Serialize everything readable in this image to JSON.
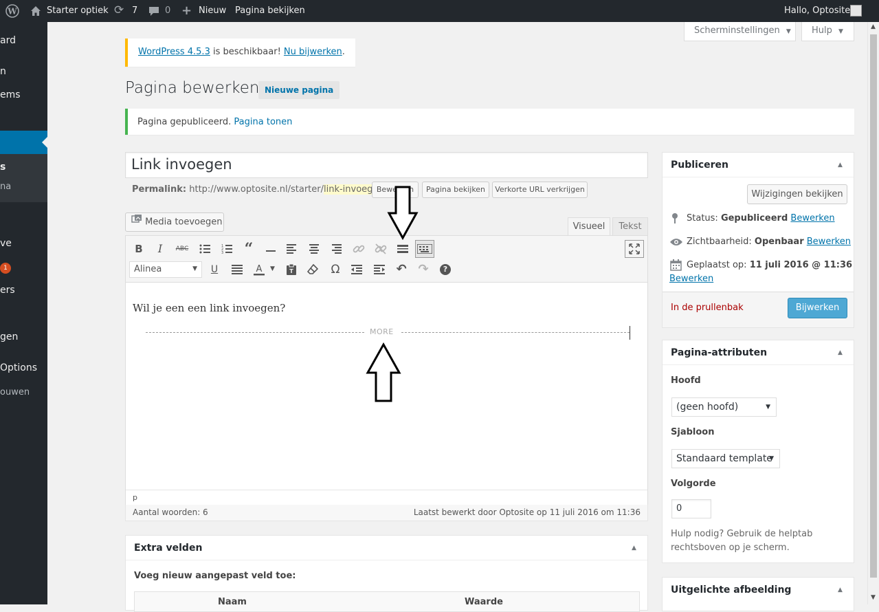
{
  "adminbar": {
    "site_name": "Starter optiek",
    "updates_count": "7",
    "comments_count": "0",
    "new_label": "Nieuw",
    "view_page": "Pagina bekijken",
    "greeting": "Hallo, Optosite"
  },
  "menu": {
    "items": [
      "ard",
      "n",
      "ems",
      "s",
      "na",
      "ve",
      "1",
      "ers",
      "gen",
      "Options",
      "ouwen"
    ]
  },
  "screen_tabs": {
    "options": "Scherminstellingen",
    "help": "Hulp"
  },
  "update_notice": {
    "link1": "WordPress 4.5.3",
    "text": " is beschikbaar! ",
    "link2": "Nu bijwerken",
    "end": "."
  },
  "page": {
    "title": "Pagina bewerken",
    "new_page": "Nieuwe pagina"
  },
  "published_notice": {
    "text": "Pagina gepubliceerd. ",
    "link": "Pagina tonen"
  },
  "post": {
    "title": "Link invoegen",
    "permalink_label": "Permalink:",
    "permalink_base": " http://www.optosite.nl/starter/",
    "permalink_slug": "link-invoegen",
    "permalink_end": "/",
    "edit_btn": "Bewerken",
    "view_btn": "Pagina bekijken",
    "shortlink_btn": "Verkorte URL verkrijgen"
  },
  "editor": {
    "add_media": "Media toevoegen",
    "tab_visual": "Visueel",
    "tab_text": "Tekst",
    "format": "Alinea",
    "content": "Wil je een een link invoegen?",
    "more": "MORE",
    "path": "p",
    "word_count": "Aantal woorden: 6",
    "last_edited": "Laatst bewerkt door Optosite op 11 juli 2016 om 11:36"
  },
  "publish_box": {
    "title": "Publiceren",
    "preview": "Wijzigingen bekijken",
    "status_label": "Status: ",
    "status_value": "Gepubliceerd",
    "visibility_label": "Zichtbaarheid: ",
    "visibility_value": "Openbaar",
    "date_label": "Geplaatst op: ",
    "date_value": "11 juli 2016 @ 11:36",
    "edit": "Bewerken",
    "trash": "In de prullenbak",
    "update": "Bijwerken"
  },
  "attributes_box": {
    "title": "Pagina-attributen",
    "parent_label": "Hoofd",
    "parent_value": "(geen hoofd)",
    "template_label": "Sjabloon",
    "template_value": "Standaard template",
    "order_label": "Volgorde",
    "order_value": "0",
    "help_line1": "Hulp nodig? Gebruik de helptab",
    "help_line2": "rechtsboven op je scherm."
  },
  "custom_fields": {
    "title": "Extra velden",
    "subtitle": "Voeg nieuw aangepast veld toe:",
    "col_name": "Naam",
    "col_value": "Waarde"
  },
  "featured_box": {
    "title": "Uitgelichte afbeelding"
  },
  "colors": {
    "adminbar": "#23282d",
    "accent": "#0073aa",
    "update_btn": "#4ea8d4",
    "notice_warning": "#ffb900",
    "notice_success": "#46b450",
    "trash": "#a00"
  }
}
